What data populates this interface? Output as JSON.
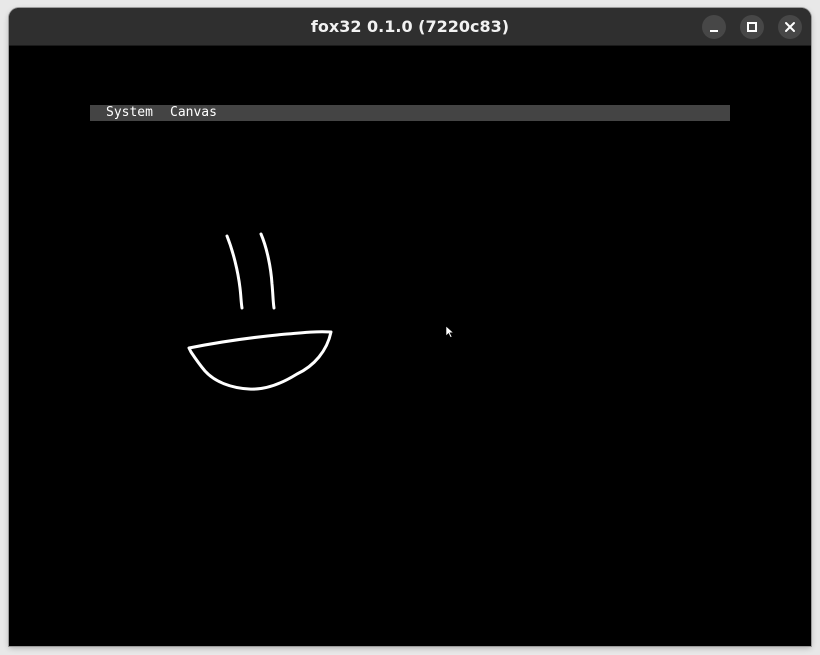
{
  "window": {
    "title": "fox32 0.1.0 (7220c83)",
    "controls": {
      "minimize_icon": "minimize-icon",
      "maximize_icon": "maximize-icon",
      "close_icon": "close-icon"
    }
  },
  "menubar": {
    "items": [
      {
        "label": "System"
      },
      {
        "label": "Canvas"
      }
    ]
  },
  "canvas": {
    "background": "#000000",
    "stroke_color": "#ffffff"
  },
  "colors": {
    "titlebar": "#2f2f2f",
    "menubar": "#444444",
    "menu_text": "#ffffff"
  }
}
